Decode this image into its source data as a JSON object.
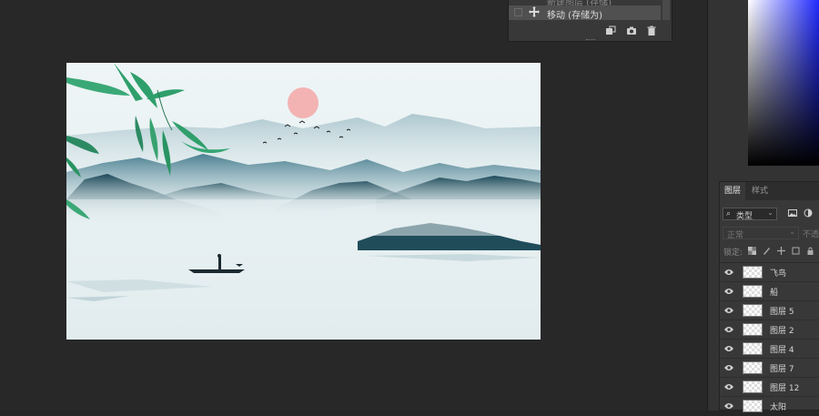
{
  "history": {
    "previous_label": "新建图层 (存储)",
    "selected_label": "移动 (存储为)",
    "toolbar_icons": [
      "new-snapshot-icon",
      "camera-icon",
      "trash-icon"
    ]
  },
  "layers_panel": {
    "tabs": [
      {
        "label": "图层"
      },
      {
        "label": "样式"
      }
    ],
    "filter": {
      "kind_label": "类型"
    },
    "blend_mode": "正常",
    "opacity_label": "不透明度",
    "lock_label": "锁定:",
    "layers": [
      {
        "name": "飞鸟"
      },
      {
        "name": "船"
      },
      {
        "name": "图层 5"
      },
      {
        "name": "图层 2"
      },
      {
        "name": "图层 4"
      },
      {
        "name": "图层 7"
      },
      {
        "name": "图层 12"
      },
      {
        "name": "太阳"
      }
    ]
  },
  "colors": {
    "workspace": "#282828",
    "panel": "#383838",
    "canvas_sky": "#e6eff0",
    "sun": "#f2b6b6",
    "mountain_dark": "#1f4e5c",
    "bamboo": "#2e9e6b"
  }
}
